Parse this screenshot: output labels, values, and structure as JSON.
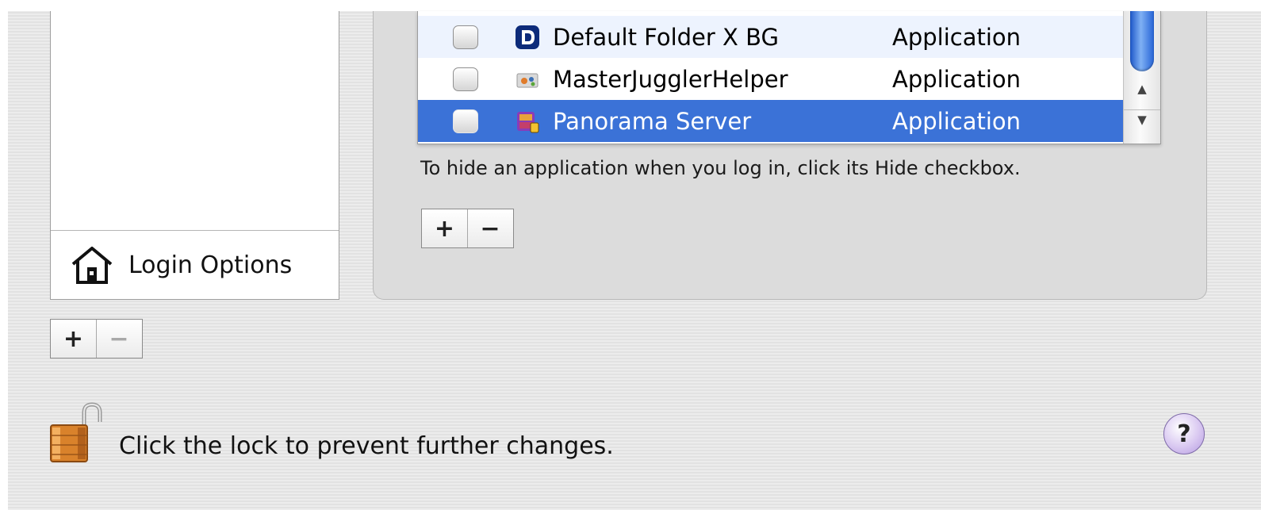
{
  "login_options": {
    "label": "Login Options",
    "icon": "house-icon"
  },
  "user_buttons": {
    "add": "+",
    "remove": "−"
  },
  "items_table": {
    "rows": [
      {
        "name": "Default Folder X BG",
        "kind": "Application",
        "icon": "default-folder-icon",
        "hidden": false,
        "selected": false
      },
      {
        "name": "MasterJugglerHelper",
        "kind": "Application",
        "icon": "masterjuggler-icon",
        "hidden": false,
        "selected": false
      },
      {
        "name": "Panorama Server",
        "kind": "Application",
        "icon": "panorama-server-icon",
        "hidden": false,
        "selected": true
      }
    ],
    "hint": "To hide an application when you log in, click its Hide checkbox.",
    "add": "+",
    "remove": "−"
  },
  "lock": {
    "text": "Click the lock to prevent further changes.",
    "icon": "unlocked-padlock-icon"
  },
  "help": {
    "label": "?"
  },
  "colors": {
    "selection": "#3b72d7",
    "alt_row": "#edf3fe",
    "help_button": "#d9c8f1"
  }
}
